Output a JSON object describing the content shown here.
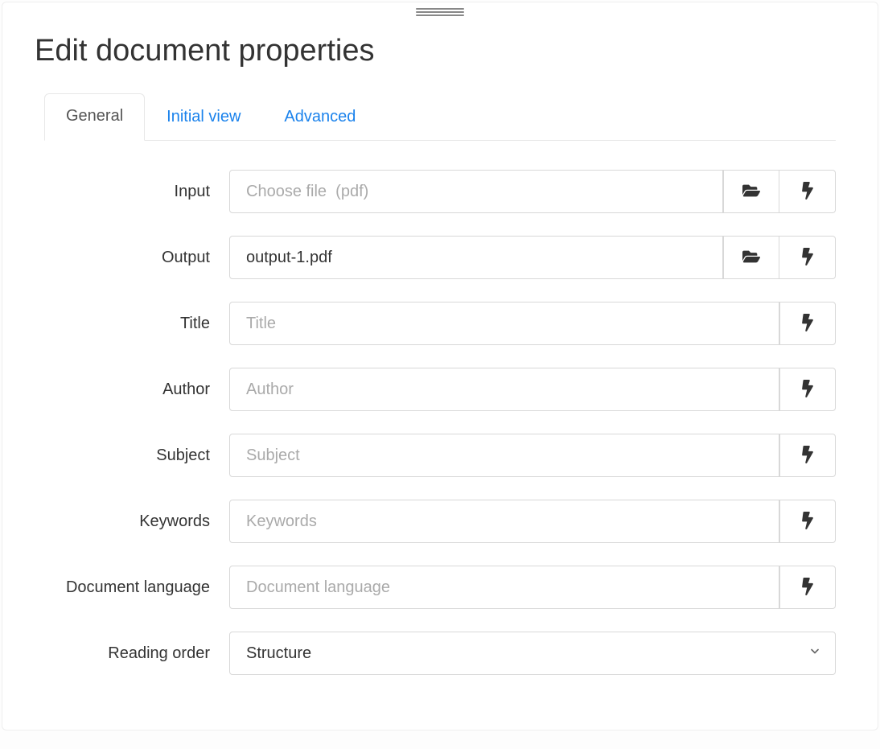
{
  "header": {
    "title": "Edit document properties"
  },
  "tabs": {
    "general": "General",
    "initial_view": "Initial view",
    "advanced": "Advanced"
  },
  "form": {
    "input": {
      "label": "Input",
      "placeholder": "Choose file  (pdf)",
      "value": ""
    },
    "output": {
      "label": "Output",
      "placeholder": "",
      "value": "output-1.pdf"
    },
    "title": {
      "label": "Title",
      "placeholder": "Title",
      "value": ""
    },
    "author": {
      "label": "Author",
      "placeholder": "Author",
      "value": ""
    },
    "subject": {
      "label": "Subject",
      "placeholder": "Subject",
      "value": ""
    },
    "keywords": {
      "label": "Keywords",
      "placeholder": "Keywords",
      "value": ""
    },
    "document_language": {
      "label": "Document language",
      "placeholder": "Document language",
      "value": ""
    },
    "reading_order": {
      "label": "Reading order",
      "selected": "Structure"
    }
  }
}
